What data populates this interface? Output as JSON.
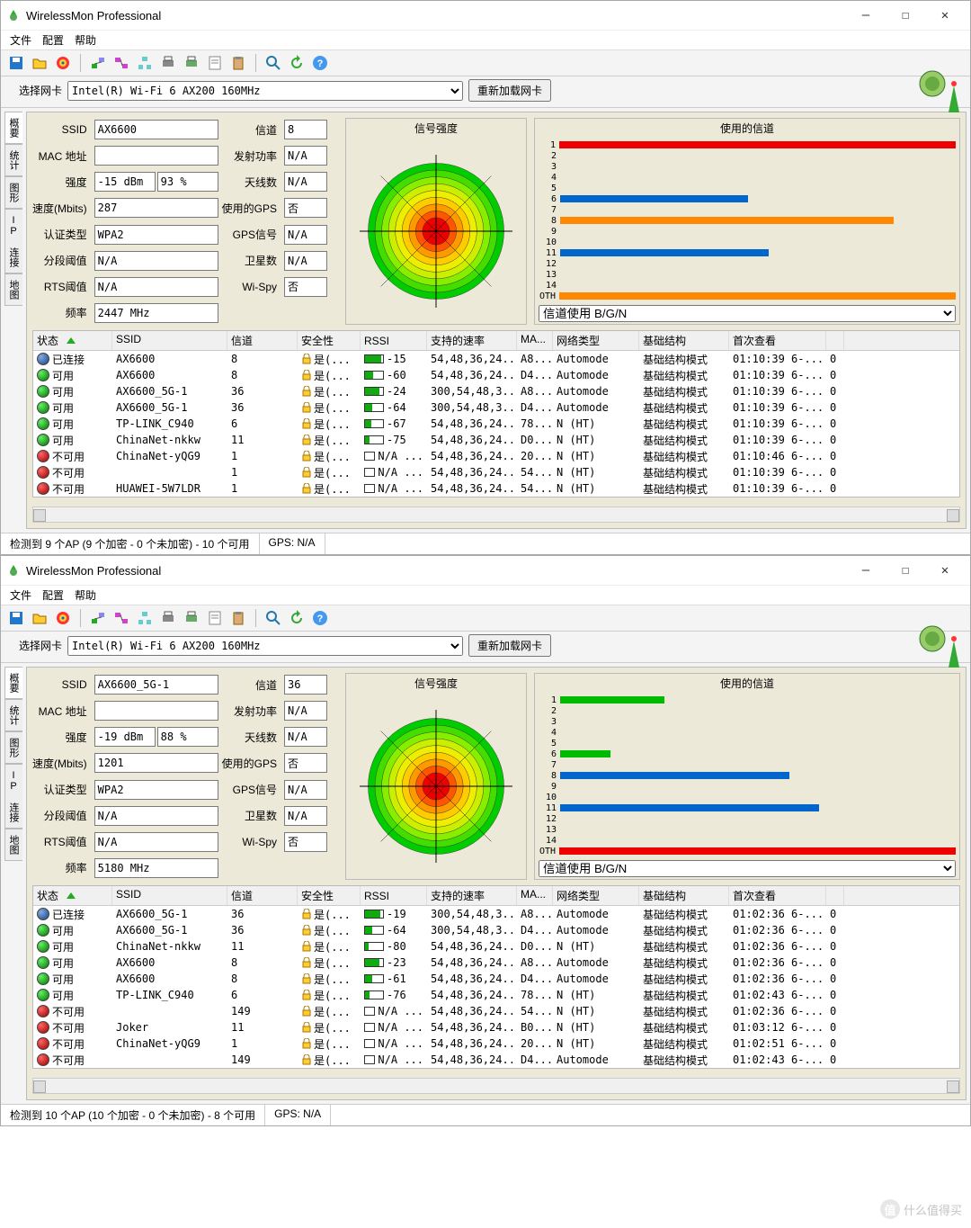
{
  "app_title": "WirelessMon Professional",
  "menus": [
    "文件",
    "配置",
    "帮助"
  ],
  "nic_label": "选择网卡",
  "nic_value": "Intel(R) Wi-Fi 6 AX200 160MHz",
  "reload_btn": "重新加载网卡",
  "vtabs": [
    "概要",
    "统计",
    "图形",
    "IP 连接",
    "地图"
  ],
  "labels": {
    "ssid": "SSID",
    "mac": "MAC 地址",
    "strength": "强度",
    "speed": "速度(Mbits)",
    "auth": "认证类型",
    "frag": "分段阈值",
    "rts": "RTS阈值",
    "freq": "频率",
    "chan": "信道",
    "tx": "发射功率",
    "ant": "天线数",
    "gps": "使用的GPS",
    "gpssig": "GPS信号",
    "sat": "卫星数",
    "wispy": "Wi-Spy"
  },
  "panel_titles": {
    "radar": "信号强度",
    "chan": "使用的信道"
  },
  "chan_filter": "信道使用 B/G/N",
  "cols": {
    "state": "状态",
    "ssid": "SSID",
    "chan": "信道",
    "sec": "安全性",
    "rssi": "RSSI",
    "rate": "支持的速率",
    "mac": "MA...",
    "nt": "网络类型",
    "infra": "基础结构",
    "first": "首次查看"
  },
  "sec_yes": "是(...",
  "infra_mode": "基础结构模式",
  "state_conn": "已连接",
  "state_avail": "可用",
  "state_unavail": "不可用",
  "w1": {
    "fields": {
      "ssid": "AX6600",
      "mac": "",
      "s_dbm": "-15 dBm",
      "s_pct": "93 %",
      "speed": "287",
      "auth": "WPA2",
      "frag": "N/A",
      "rts": "N/A",
      "freq": "2447 MHz",
      "chan": "8",
      "tx": "N/A",
      "ant": "N/A",
      "gps": "否",
      "gpssig": "N/A",
      "sat": "N/A",
      "wispy": "否"
    },
    "rows": [
      {
        "st": "conn",
        "ssid": "AX6600",
        "ch": "8",
        "rssi": "-15",
        "rfill": 90,
        "rate": "54,48,36,24...",
        "mac": "A8...",
        "nt": "Automode",
        "first": "01:10:39 6-..."
      },
      {
        "st": "avail",
        "ssid": "AX6600",
        "ch": "8",
        "rssi": "-60",
        "rfill": 45,
        "rate": "54,48,36,24...",
        "mac": "D4...",
        "nt": "Automode",
        "first": "01:10:39 6-..."
      },
      {
        "st": "avail",
        "ssid": "AX6600_5G-1",
        "ch": "36",
        "rssi": "-24",
        "rfill": 80,
        "rate": "300,54,48,3...",
        "mac": "A8...",
        "nt": "Automode",
        "first": "01:10:39 6-..."
      },
      {
        "st": "avail",
        "ssid": "AX6600_5G-1",
        "ch": "36",
        "rssi": "-64",
        "rfill": 40,
        "rate": "300,54,48,3...",
        "mac": "D4...",
        "nt": "Automode",
        "first": "01:10:39 6-..."
      },
      {
        "st": "avail",
        "ssid": "TP-LINK_C940",
        "ch": "6",
        "rssi": "-67",
        "rfill": 35,
        "rate": "54,48,36,24...",
        "mac": "78...",
        "nt": "N (HT)",
        "first": "01:10:39 6-..."
      },
      {
        "st": "avail",
        "ssid": "ChinaNet-nkkw",
        "ch": "11",
        "rssi": "-75",
        "rfill": 25,
        "rate": "54,48,36,24...",
        "mac": "D0...",
        "nt": "N (HT)",
        "first": "01:10:39 6-..."
      },
      {
        "st": "unavail",
        "ssid": "ChinaNet-yQG9",
        "ch": "1",
        "rssi": "N/A ...",
        "rfill": 0,
        "rate": "54,48,36,24...",
        "mac": "20...",
        "nt": "N (HT)",
        "first": "01:10:46 6-..."
      },
      {
        "st": "unavail",
        "ssid": "",
        "ch": "1",
        "rssi": "N/A ...",
        "rfill": 0,
        "rate": "54,48,36,24...",
        "mac": "54...",
        "nt": "N (HT)",
        "first": "01:10:39 6-..."
      },
      {
        "st": "unavail",
        "ssid": "HUAWEI-5W7LDR",
        "ch": "1",
        "rssi": "N/A ...",
        "rfill": 0,
        "rate": "54,48,36,24...",
        "mac": "54...",
        "nt": "N (HT)",
        "first": "01:10:39 6-..."
      }
    ],
    "status": {
      "ap": "检测到 9 个AP (9 个加密 - 0 个未加密) - 10 个可用",
      "gps": "GPS: N/A"
    },
    "chart_data": {
      "type": "bar",
      "title": "使用的信道",
      "categories": [
        "1",
        "2",
        "3",
        "4",
        "5",
        "6",
        "7",
        "8",
        "9",
        "10",
        "11",
        "12",
        "13",
        "14",
        "OTH"
      ],
      "series": [
        {
          "name": "ch1",
          "value": 100,
          "color": "#e00"
        },
        {
          "name": "ch6",
          "value": 45,
          "color": "#06c"
        },
        {
          "name": "ch8",
          "value": 80,
          "color": "#f80"
        },
        {
          "name": "ch11",
          "value": 50,
          "color": "#06c"
        },
        {
          "name": "OTH",
          "value": 100,
          "color": "#f80"
        }
      ]
    }
  },
  "w2": {
    "fields": {
      "ssid": "AX6600_5G-1",
      "mac": "",
      "s_dbm": "-19 dBm",
      "s_pct": "88 %",
      "speed": "1201",
      "auth": "WPA2",
      "frag": "N/A",
      "rts": "N/A",
      "freq": "5180 MHz",
      "chan": "36",
      "tx": "N/A",
      "ant": "N/A",
      "gps": "否",
      "gpssig": "N/A",
      "sat": "N/A",
      "wispy": "否"
    },
    "rows": [
      {
        "st": "conn",
        "ssid": "AX6600_5G-1",
        "ch": "36",
        "rssi": "-19",
        "rfill": 85,
        "rate": "300,54,48,3...",
        "mac": "A8...",
        "nt": "Automode",
        "first": "01:02:36 6-..."
      },
      {
        "st": "avail",
        "ssid": "AX6600_5G-1",
        "ch": "36",
        "rssi": "-64",
        "rfill": 40,
        "rate": "300,54,48,3...",
        "mac": "D4...",
        "nt": "Automode",
        "first": "01:02:36 6-..."
      },
      {
        "st": "avail",
        "ssid": "ChinaNet-nkkw",
        "ch": "11",
        "rssi": "-80",
        "rfill": 20,
        "rate": "54,48,36,24...",
        "mac": "D0...",
        "nt": "N (HT)",
        "first": "01:02:36 6-..."
      },
      {
        "st": "avail",
        "ssid": "AX6600",
        "ch": "8",
        "rssi": "-23",
        "rfill": 80,
        "rate": "54,48,36,24...",
        "mac": "A8...",
        "nt": "Automode",
        "first": "01:02:36 6-..."
      },
      {
        "st": "avail",
        "ssid": "AX6600",
        "ch": "8",
        "rssi": "-61",
        "rfill": 42,
        "rate": "54,48,36,24...",
        "mac": "D4...",
        "nt": "Automode",
        "first": "01:02:36 6-..."
      },
      {
        "st": "avail",
        "ssid": "TP-LINK_C940",
        "ch": "6",
        "rssi": "-76",
        "rfill": 25,
        "rate": "54,48,36,24...",
        "mac": "78...",
        "nt": "N (HT)",
        "first": "01:02:43 6-..."
      },
      {
        "st": "unavail",
        "ssid": "",
        "ch": "149",
        "rssi": "N/A ...",
        "rfill": 0,
        "rate": "54,48,36,24...",
        "mac": "54...",
        "nt": "N (HT)",
        "first": "01:02:36 6-..."
      },
      {
        "st": "unavail",
        "ssid": "Joker",
        "ch": "11",
        "rssi": "N/A ...",
        "rfill": 0,
        "rate": "54,48,36,24...",
        "mac": "B0...",
        "nt": "N (HT)",
        "first": "01:03:12 6-..."
      },
      {
        "st": "unavail",
        "ssid": "ChinaNet-yQG9",
        "ch": "1",
        "rssi": "N/A ...",
        "rfill": 0,
        "rate": "54,48,36,24...",
        "mac": "20...",
        "nt": "N (HT)",
        "first": "01:02:51 6-..."
      },
      {
        "st": "unavail",
        "ssid": "",
        "ch": "149",
        "rssi": "N/A ...",
        "rfill": 0,
        "rate": "54,48,36,24...",
        "mac": "D4...",
        "nt": "Automode",
        "first": "01:02:43 6-..."
      }
    ],
    "status": {
      "ap": "检测到 10 个AP (10 个加密 - 0 个未加密) - 8 个可用",
      "gps": "GPS: N/A"
    },
    "chart_data": {
      "type": "bar",
      "title": "使用的信道",
      "categories": [
        "1",
        "2",
        "3",
        "4",
        "5",
        "6",
        "7",
        "8",
        "9",
        "10",
        "11",
        "12",
        "13",
        "14",
        "OTH"
      ],
      "series": [
        {
          "name": "ch1",
          "value": 25,
          "color": "#0b0"
        },
        {
          "name": "ch6",
          "value": 12,
          "color": "#0b0"
        },
        {
          "name": "ch8",
          "value": 55,
          "color": "#06c"
        },
        {
          "name": "ch11",
          "value": 62,
          "color": "#06c"
        },
        {
          "name": "OTH",
          "value": 100,
          "color": "#e00"
        }
      ]
    }
  },
  "watermark": "什么值得买"
}
